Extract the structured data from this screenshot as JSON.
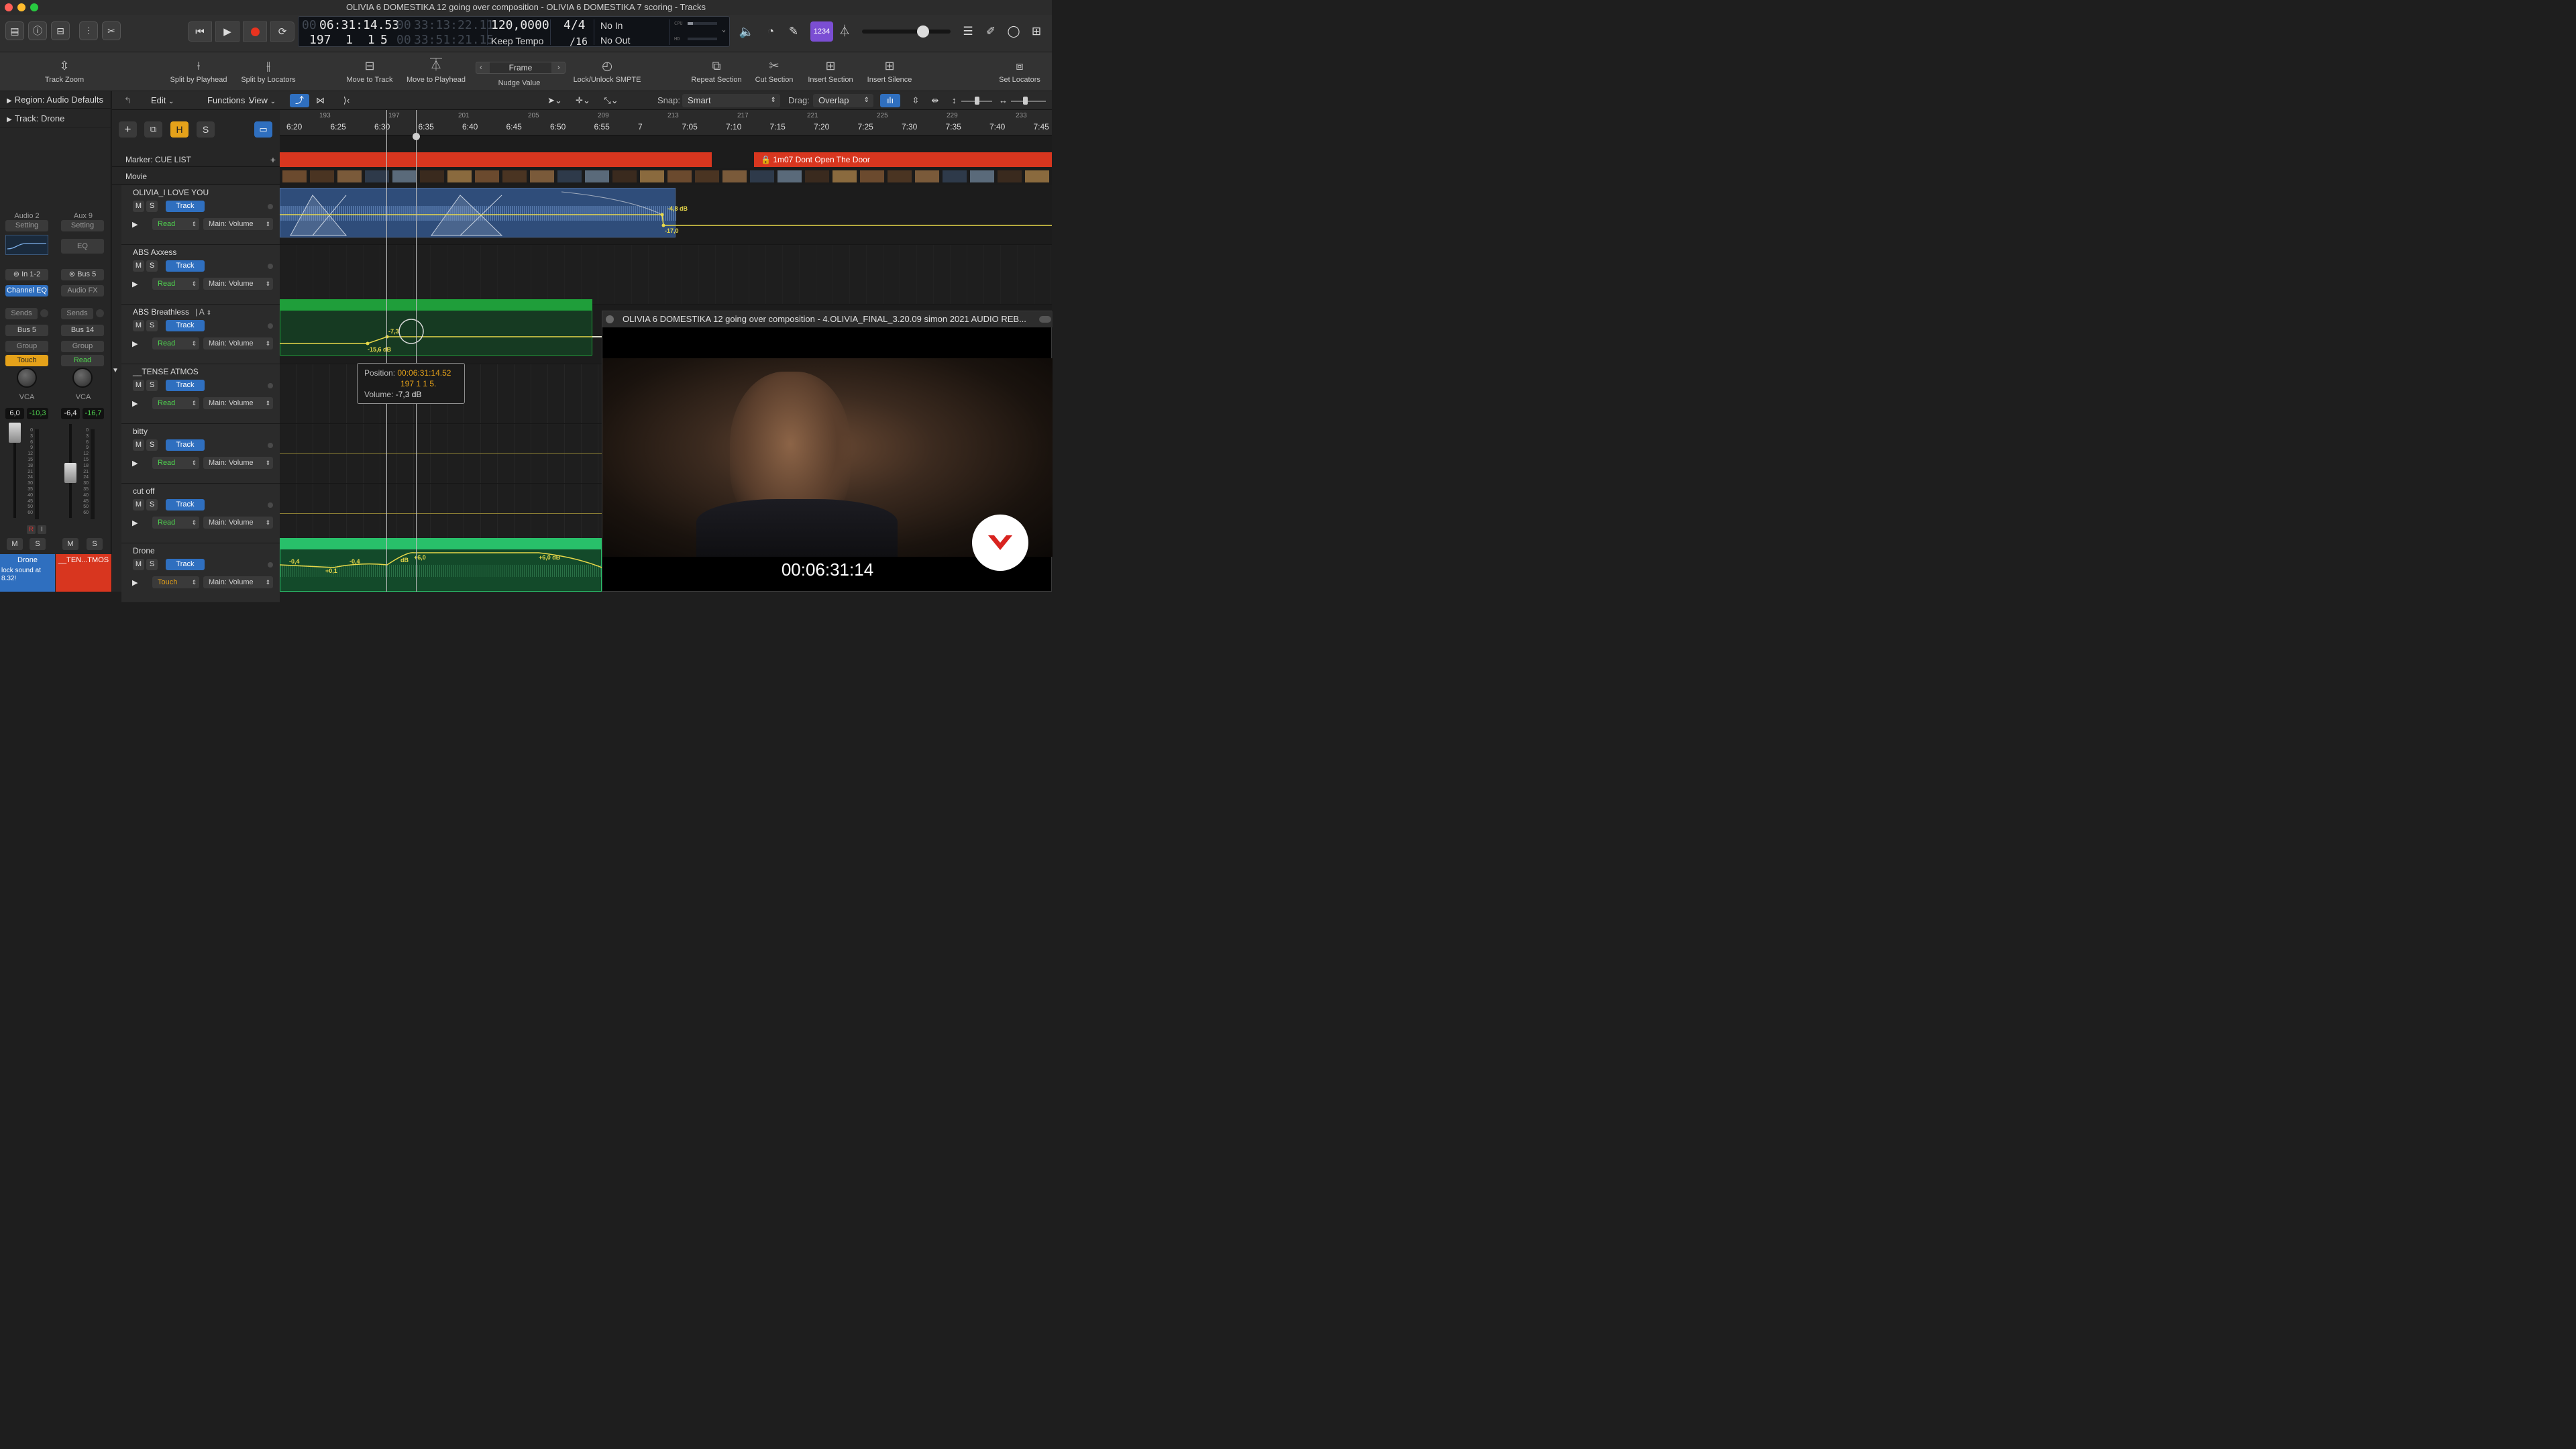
{
  "window": {
    "title": "OLIVIA 6 DOMESTIKA 12 going over composition - OLIVIA 6 DOMESTIKA 7 scoring - Tracks"
  },
  "lcd": {
    "time": "06:31:14.53",
    "time_prefix": "00",
    "smpte": "33:13:22.11",
    "smpte_prefix": "00",
    "bars": "197  1  1",
    "ticks": "5",
    "smpte2": "33:51:21.15",
    "smpte2_prefix": "00",
    "tempo": "120,0000",
    "tempo_mode": "Keep Tempo",
    "signature": "4/4",
    "division": "/16",
    "in_label": "No In",
    "out_label": "No Out",
    "cpu_label": "CPU",
    "hd_label": "HD"
  },
  "control_bar": {
    "count_in_label": "1234"
  },
  "toolbar": {
    "track_zoom": "Track Zoom",
    "split_playhead": "Split by Playhead",
    "split_locators": "Split by Locators",
    "move_to_track": "Move to Track",
    "move_to_playhead": "Move to Playhead",
    "nudge_value_field": "Frame",
    "nudge_value": "Nudge Value",
    "lock_smpte": "Lock/Unlock SMPTE",
    "repeat_section": "Repeat Section",
    "cut_section": "Cut Section",
    "insert_section": "Insert Section",
    "insert_silence": "Insert Silence",
    "set_locators": "Set Locators"
  },
  "inspector": {
    "region_label": "Region: Audio Defaults",
    "track_label": "Track: Drone",
    "strip1": {
      "name": "Audio 2",
      "setting": "Setting",
      "input": "In 1-2",
      "eq": "Channel EQ",
      "sends": "Sends",
      "bus": "Bus 5",
      "group": "Group",
      "automation": "Touch",
      "vca": "VCA",
      "vol": "6,0",
      "peak": "-10,3",
      "m": "M",
      "s": "S",
      "r": "R",
      "i": "I",
      "label": "Drone",
      "note": "lock sound at 8.32!"
    },
    "strip2": {
      "name": "Aux 9",
      "setting": "Setting",
      "eq": "EQ",
      "input": "Bus 5",
      "fx": "Audio FX",
      "sends": "Sends",
      "bus": "Bus 14",
      "group": "Group",
      "automation": "Read",
      "vca": "VCA",
      "vol": "-6,4",
      "peak": "-16,7",
      "m": "M",
      "s": "S",
      "label": "__TEN...TMOS"
    },
    "meter_scale": [
      "0",
      "3",
      "6",
      "9",
      "12",
      "15",
      "18",
      "21",
      "24",
      "30",
      "35",
      "40",
      "45",
      "50",
      "60"
    ]
  },
  "tracks_menu": {
    "edit": "Edit",
    "functions": "Functions",
    "view": "View",
    "snap_label": "Snap:",
    "snap_value": "Smart",
    "drag_label": "Drag:",
    "drag_value": "Overlap"
  },
  "global_tracks": {
    "marker_label": "Marker: CUE LIST",
    "movie_label": "Movie",
    "marker_text": "1m07 Dont Open The Door"
  },
  "header_buttons": {
    "h": "H",
    "s": "S"
  },
  "tracks": [
    {
      "name": "OLIVIA_I LOVE YOU",
      "m": "M",
      "s": "S",
      "track_btn": "Track",
      "mode": "Read",
      "param": "Main: Volume"
    },
    {
      "name": "ABS Axxess",
      "m": "M",
      "s": "S",
      "track_btn": "Track",
      "mode": "Read",
      "param": "Main: Volume"
    },
    {
      "name": "ABS Breathless",
      "suffix": "A",
      "m": "M",
      "s": "S",
      "track_btn": "Track",
      "mode": "Read",
      "param": "Main: Volume"
    },
    {
      "name": "__TENSE ATMOS",
      "m": "M",
      "s": "S",
      "track_btn": "Track",
      "mode": "Read",
      "param": "Main: Volume"
    },
    {
      "name": "bitty",
      "m": "M",
      "s": "S",
      "track_btn": "Track",
      "mode": "Read",
      "param": "Main: Volume"
    },
    {
      "name": "cut off",
      "m": "M",
      "s": "S",
      "track_btn": "Track",
      "mode": "Read",
      "param": "Main: Volume"
    },
    {
      "name": "Drone",
      "m": "M",
      "s": "S",
      "track_btn": "Track",
      "mode": "Touch",
      "param": "Main: Volume"
    }
  ],
  "ruler": {
    "bars": [
      "193",
      "197",
      "201",
      "205",
      "209",
      "213",
      "217",
      "221",
      "225",
      "229",
      "233"
    ],
    "times": [
      "6:20",
      "6:25",
      "6:30",
      "6:35",
      "6:40",
      "6:45",
      "6:50",
      "6:55",
      "7",
      "7:05",
      "7:10",
      "7:15",
      "7:20",
      "7:25",
      "7:30",
      "7:35",
      "7:40",
      "7:45"
    ]
  },
  "automation_labels": {
    "olivia_a": "-4,8 dB",
    "olivia_b": "-17,0",
    "breathless_a": "-15,6 dB",
    "breathless_b": "-7,3",
    "drone": [
      "-0,4",
      "+0,1",
      "-0,4",
      "dB",
      "+6,0",
      "+6,0 dB"
    ]
  },
  "tooltip": {
    "position_label": "Position:",
    "position_value": "00:06:31:14.52",
    "bar_value": "197 1 1 5.",
    "volume_label": "Volume:",
    "volume_value": "-7,3 dB"
  },
  "movie_window": {
    "title": "OLIVIA 6 DOMESTIKA 12 going over composition - 4.OLIVIA_FINAL_3.20.09 simon 2021 AUDIO REB...",
    "timecode": "00:06:31:14"
  },
  "colors": {
    "accent_blue": "#2f6fbf",
    "marker_red": "#d8361f",
    "region_green": "#1f9e3a",
    "automation_yellow": "#e8d84a",
    "lcd_bg": "#0f1217"
  }
}
